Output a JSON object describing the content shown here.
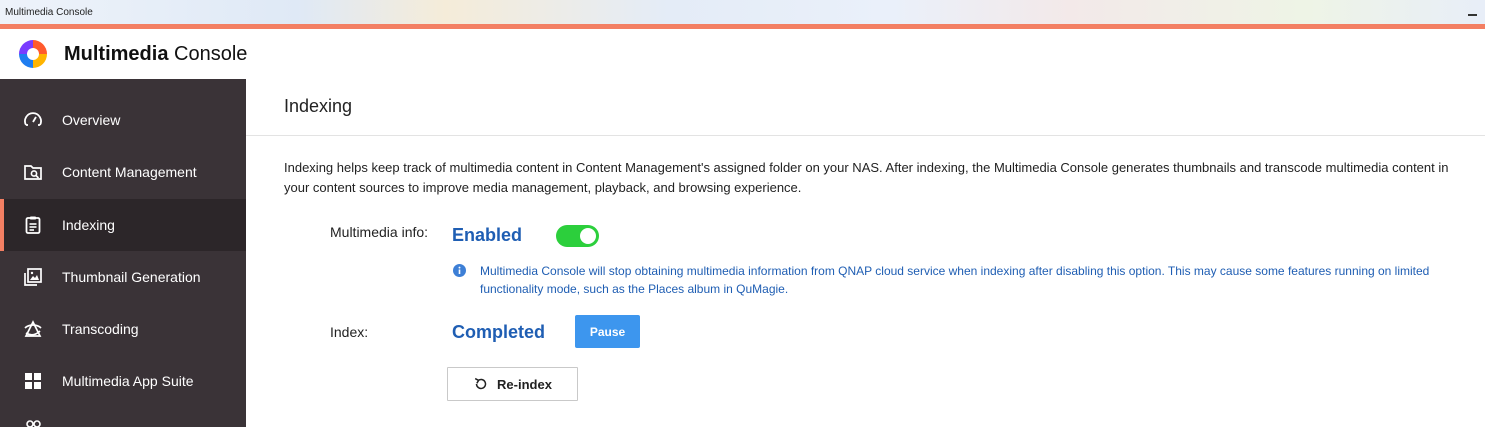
{
  "window": {
    "title": "Multimedia Console",
    "minimize_icon": "minimize-icon"
  },
  "header": {
    "logo_icon": "multimedia-console-logo",
    "app_name_bold": "Multimedia",
    "app_name_regular": " Console"
  },
  "sidebar": {
    "items": [
      {
        "label": "Overview",
        "icon": "gauge-icon",
        "active": false
      },
      {
        "label": "Content Management",
        "icon": "folder-search-icon",
        "active": false
      },
      {
        "label": "Indexing",
        "icon": "clipboard-icon",
        "active": true
      },
      {
        "label": "Thumbnail Generation",
        "icon": "image-gallery-icon",
        "active": false
      },
      {
        "label": "Transcoding",
        "icon": "transcode-icon",
        "active": false
      },
      {
        "label": "Multimedia App Suite",
        "icon": "grid-icon",
        "active": false
      }
    ]
  },
  "main": {
    "title": "Indexing",
    "description": "Indexing helps keep track of multimedia content in Content Management's assigned folder on your NAS. After indexing, the Multimedia Console generates thumbnails and transcode multimedia content in your content sources to improve media management, playback, and browsing experience.",
    "multimedia_info": {
      "label": "Multimedia info:",
      "status": "Enabled",
      "toggle_on": true,
      "note": "Multimedia Console will stop obtaining multimedia information from QNAP cloud service when indexing after disabling this option. This may cause some features running on limited functionality mode, such as the Places album in QuMagie."
    },
    "index": {
      "label": "Index:",
      "status": "Completed",
      "pause_label": "Pause",
      "reindex_label": "Re-index"
    }
  },
  "colors": {
    "accent": "#f37f63",
    "sidebar_bg": "#3a3337",
    "status_blue": "#1f5eb3",
    "toggle_green": "#2ccf3c",
    "button_blue": "#3d96ee"
  }
}
